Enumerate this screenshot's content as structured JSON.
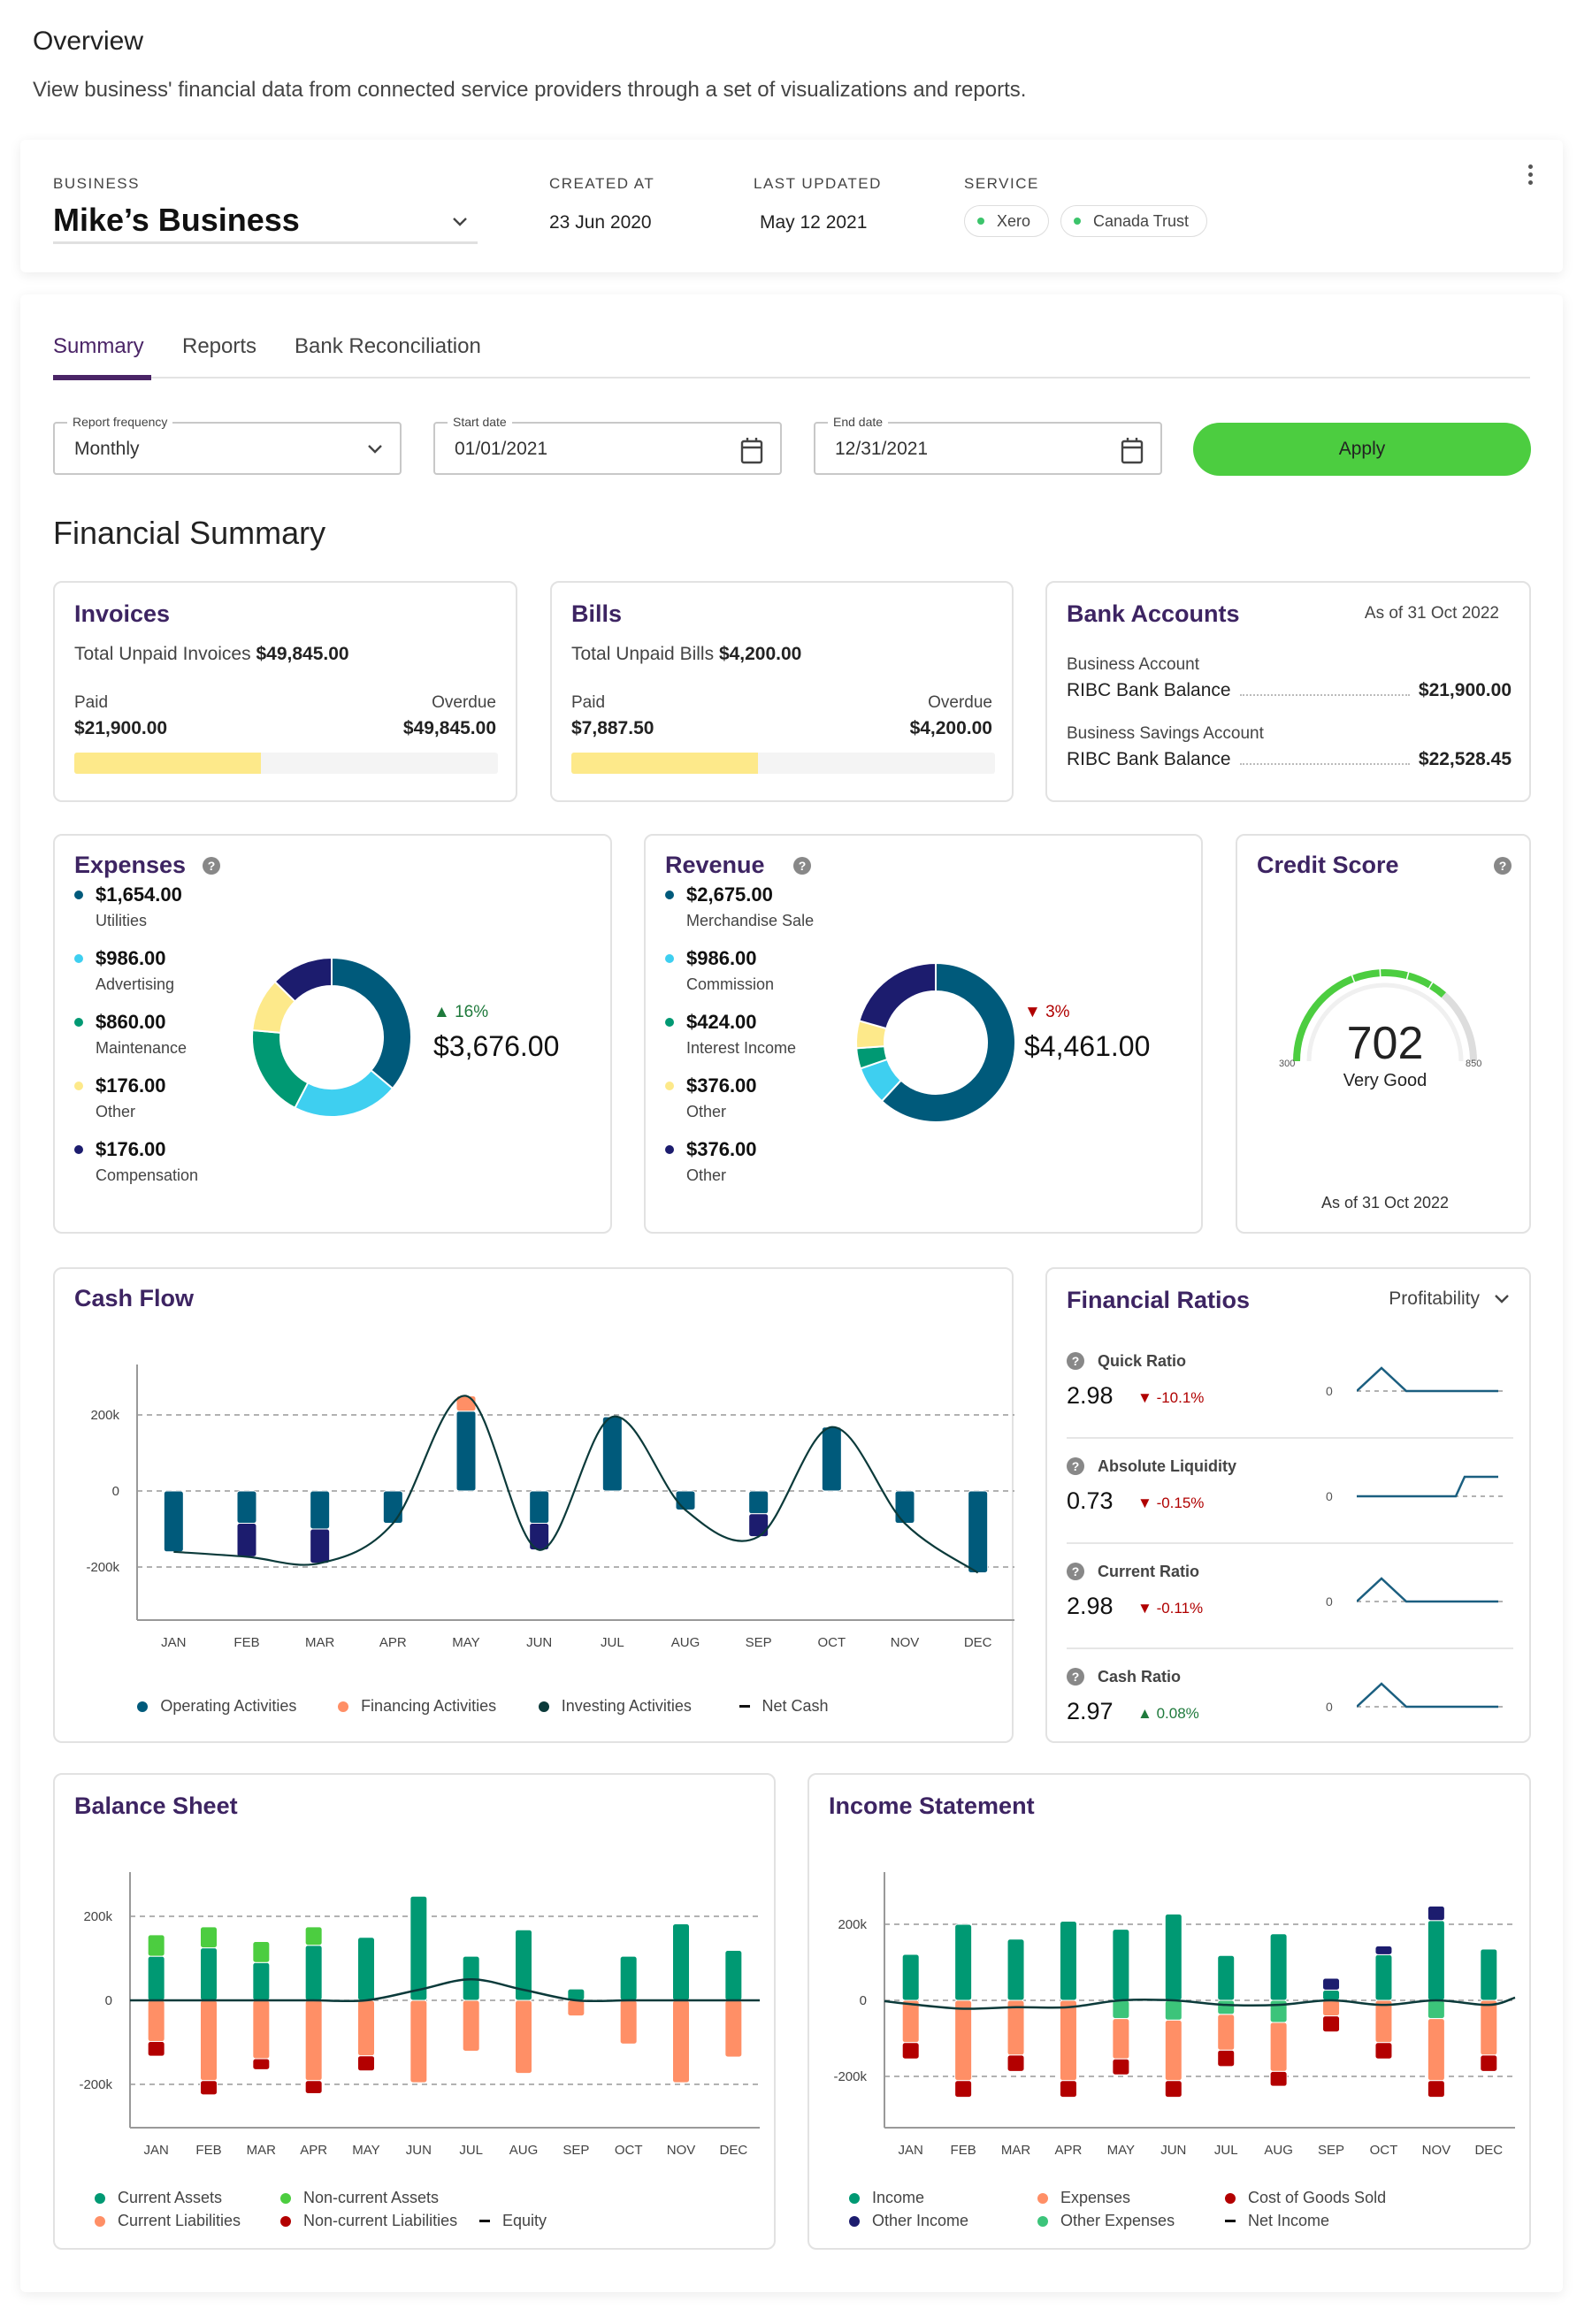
{
  "page": {
    "title": "Overview",
    "subtitle": "View business' financial data from connected service providers through a set of visualizations and reports."
  },
  "header": {
    "business_label": "BUSINESS",
    "business_name": "Mike’s Business",
    "created_label": "CREATED AT",
    "created_value": "23 Jun 2020",
    "updated_label": "LAST UPDATED",
    "updated_value": "May 12 2021",
    "service_label": "SERVICE",
    "services": [
      "Xero",
      "Canada Trust"
    ]
  },
  "tabs": [
    {
      "label": "Summary",
      "active": true
    },
    {
      "label": "Reports",
      "active": false
    },
    {
      "label": "Bank Reconciliation",
      "active": false
    }
  ],
  "filters": {
    "frequency_label": "Report frequency",
    "frequency_value": "Monthly",
    "start_label": "Start date",
    "start_value": "01/01/2021",
    "end_label": "End date",
    "end_value": "12/31/2021",
    "apply_label": "Apply"
  },
  "section_title": "Financial Summary",
  "invoices": {
    "title": "Invoices",
    "total_label": "Total Unpaid Invoices",
    "total_value": "$49,845.00",
    "paid_label": "Paid",
    "paid_value": "$21,900.00",
    "overdue_label": "Overdue",
    "overdue_value": "$49,845.00",
    "paid_fraction": 0.44
  },
  "bills": {
    "title": "Bills",
    "total_label": "Total Unpaid Bills",
    "total_value": "$4,200.00",
    "paid_label": "Paid",
    "paid_value": "$7,887.50",
    "overdue_label": "Overdue",
    "overdue_value": "$4,200.00",
    "paid_fraction": 0.44
  },
  "bank_accounts": {
    "title": "Bank Accounts",
    "as_of": "As of 31 Oct 2022",
    "accounts": [
      {
        "type": "Business Account",
        "name": "RIBC Bank Balance",
        "balance": "$21,900.00"
      },
      {
        "type": "Business Savings Account",
        "name": "RIBC Bank Balance",
        "balance": "$22,528.45"
      }
    ]
  },
  "colors": {
    "brand_purple": "#3d2462",
    "apply_green": "#4ccd40",
    "teal_dark": "#005a7b",
    "cyan": "#3ecff0",
    "green": "#009973",
    "yellow": "#fde98a",
    "navy": "#1c1c6e",
    "orange": "#ff8f66",
    "light_green": "#4ccd40",
    "dark_red": "#b30000",
    "mint": "#3cc47a",
    "up": "#1f7a3c",
    "down": "#b00000"
  },
  "expenses": {
    "title": "Expenses",
    "change": "16%",
    "change_dir": "up",
    "total": "$3,676.00",
    "items": [
      {
        "amount": "$1,654.00",
        "label": "Utilities",
        "value": 1654,
        "color": "#005a7b"
      },
      {
        "amount": "$986.00",
        "label": "Advertising",
        "value": 986,
        "color": "#3ecff0"
      },
      {
        "amount": "$860.00",
        "label": "Maintenance",
        "value": 860,
        "color": "#009973"
      },
      {
        "amount": "$176.00",
        "label": "Other",
        "value": 500,
        "color": "#fde98a"
      },
      {
        "amount": "$176.00",
        "label": "Compensation",
        "value": 580,
        "color": "#1c1c6e"
      }
    ]
  },
  "revenue": {
    "title": "Revenue",
    "change": "3%",
    "change_dir": "down",
    "total": "$4,461.00",
    "items": [
      {
        "amount": "$2,675.00",
        "label": "Merchandise Sale",
        "value": 2675,
        "color": "#005a7b"
      },
      {
        "amount": "$986.00",
        "label": "Commission",
        "value": 340,
        "color": "#3ecff0"
      },
      {
        "amount": "$424.00",
        "label": "Interest Income",
        "value": 180,
        "color": "#009973"
      },
      {
        "amount": "$376.00",
        "label": "Other",
        "value": 240,
        "color": "#fde98a"
      },
      {
        "amount": "$376.00",
        "label": "Other",
        "value": 890,
        "color": "#1c1c6e"
      }
    ]
  },
  "credit_score": {
    "title": "Credit Score",
    "score": "702",
    "score_value": 702,
    "rating": "Very Good",
    "min": "300",
    "max": "850",
    "min_value": 300,
    "max_value": 850,
    "as_of": "As of 31 Oct 2022"
  },
  "ratios": {
    "title": "Financial Ratios",
    "selector": "Profitability",
    "items": [
      {
        "name": "Quick Ratio",
        "value": "2.98",
        "change": "-10.1%",
        "dir": "down",
        "axis": "0",
        "spark": [
          0,
          1,
          0,
          0,
          0,
          0,
          0
        ]
      },
      {
        "name": "Absolute Liquidity",
        "value": "0.73",
        "change": "-0.15%",
        "dir": "down",
        "axis": "0",
        "spark": [
          0,
          0,
          0,
          0,
          0,
          1,
          1
        ]
      },
      {
        "name": "Current Ratio",
        "value": "2.98",
        "change": "-0.11%",
        "dir": "down",
        "axis": "0",
        "spark": [
          0,
          1,
          0,
          0,
          0,
          0,
          0
        ]
      },
      {
        "name": "Cash Ratio",
        "value": "2.97",
        "change": "0.08%",
        "dir": "up",
        "axis": "0",
        "spark": [
          0,
          1,
          0,
          0,
          0,
          0,
          0
        ]
      }
    ]
  },
  "chart_data": [
    {
      "id": "cashflow",
      "type": "bar",
      "title": "Cash Flow",
      "categories": [
        "JAN",
        "FEB",
        "MAR",
        "APR",
        "MAY",
        "JUN",
        "JUL",
        "AUG",
        "SEP",
        "OCT",
        "NOV",
        "DEC"
      ],
      "yticks": [
        "200k",
        "0",
        "-200k"
      ],
      "ytick_values": [
        200,
        0,
        -200
      ],
      "ylim": [
        -340,
        340
      ],
      "grid": true,
      "legend_position": "bottom",
      "series": [
        {
          "name": "Operating Activities",
          "color": "#005a7b",
          "values": [
            -160,
            -85,
            -100,
            -85,
            210,
            -85,
            195,
            -50,
            -60,
            168,
            -85,
            -215
          ]
        },
        {
          "name": "Financing Activities",
          "color": "#ff8f66",
          "values": [
            0,
            0,
            0,
            0,
            40,
            0,
            0,
            0,
            0,
            0,
            0,
            0
          ]
        },
        {
          "name": "Investing Activities",
          "color": "#1c1c6e",
          "values": [
            0,
            -88,
            -90,
            0,
            0,
            -70,
            0,
            0,
            -60,
            0,
            0,
            0
          ]
        }
      ],
      "line": {
        "name": "Net Cash",
        "color": "#0b3a3a",
        "values": [
          -160,
          -173,
          -190,
          -85,
          250,
          -155,
          195,
          -50,
          -120,
          168,
          -85,
          -215
        ]
      },
      "legend": [
        {
          "label": "Operating Activities",
          "color": "#005a7b",
          "kind": "dot"
        },
        {
          "label": "Financing Activities",
          "color": "#ff8f66",
          "kind": "dot"
        },
        {
          "label": "Investing Activities",
          "color": "#0b3a3a",
          "kind": "dot"
        },
        {
          "label": "Net Cash",
          "color": "#111111",
          "kind": "line"
        }
      ]
    },
    {
      "id": "balance",
      "type": "bar",
      "title": "Balance Sheet",
      "categories": [
        "JAN",
        "FEB",
        "MAR",
        "APR",
        "MAY",
        "JUN",
        "JUL",
        "AUG",
        "SEP",
        "OCT",
        "NOV",
        "DEC"
      ],
      "yticks": [
        "200k",
        "0",
        "-200k"
      ],
      "ytick_values": [
        200,
        0,
        -200
      ],
      "ylim": [
        -335,
        335
      ],
      "grid": true,
      "legend_position": "bottom",
      "series": [
        {
          "name": "Current Assets",
          "color": "#009973",
          "values": [
            105,
            125,
            90,
            131,
            150,
            248,
            105,
            168,
            27,
            105,
            182,
            119
          ]
        },
        {
          "name": "Non-current Assets",
          "color": "#4ccd40",
          "values": [
            51,
            50,
            50,
            44,
            0,
            0,
            0,
            0,
            0,
            0,
            0,
            0
          ]
        },
        {
          "name": "Current Liabilities",
          "color": "#ff8f66",
          "values": [
            -98,
            -191,
            -139,
            -191,
            -132,
            -196,
            -121,
            -174,
            -37,
            -104,
            -196,
            -135
          ]
        },
        {
          "name": "Non-current Liabilities",
          "color": "#b30000",
          "values": [
            -35,
            -34,
            -26,
            -31,
            -36,
            0,
            0,
            0,
            0,
            0,
            0,
            0
          ]
        }
      ],
      "line": {
        "name": "Equity",
        "color": "#0b3a3a",
        "values": [
          0,
          0,
          0,
          0,
          0,
          25,
          50,
          25,
          0,
          0,
          0,
          0
        ]
      },
      "legend": [
        {
          "label": "Current Assets",
          "color": "#009973",
          "kind": "dot"
        },
        {
          "label": "Non-current Assets",
          "color": "#4ccd40",
          "kind": "dot"
        },
        {
          "label": "Current Liabilities",
          "color": "#ff8f66",
          "kind": "dot"
        },
        {
          "label": "Non-current Liabilities",
          "color": "#b30000",
          "kind": "dot"
        },
        {
          "label": "Equity",
          "color": "#111111",
          "kind": "line"
        }
      ]
    },
    {
      "id": "income",
      "type": "bar",
      "title": "Income Statement",
      "categories": [
        "JAN",
        "FEB",
        "MAR",
        "APR",
        "MAY",
        "JUN",
        "JUL",
        "AUG",
        "SEP",
        "OCT",
        "NOV",
        "DEC"
      ],
      "yticks": [
        "200k",
        "0",
        "-200k"
      ],
      "ytick_values": [
        200,
        0,
        -200
      ],
      "ylim": [
        -335,
        335
      ],
      "grid": true,
      "legend_position": "bottom",
      "series": [
        {
          "name": "Income",
          "color": "#009973",
          "values": [
            121,
            200,
            161,
            208,
            187,
            227,
            118,
            175,
            27,
            120,
            210,
            135
          ]
        },
        {
          "name": "Other Income",
          "color": "#1c1c6e",
          "values": [
            0,
            0,
            0,
            0,
            0,
            0,
            0,
            0,
            31,
            23,
            38,
            0
          ]
        },
        {
          "name": "Other Expenses",
          "color": "#3cc47a",
          "values": [
            0,
            0,
            0,
            0,
            -48,
            -52,
            -37,
            -58,
            0,
            0,
            -48,
            0
          ]
        },
        {
          "name": "Expenses",
          "color": "#ff8f66",
          "values": [
            -111,
            -211,
            -144,
            -211,
            -106,
            -159,
            -94,
            -129,
            -41,
            -111,
            -163,
            -144
          ]
        },
        {
          "name": "Cost of Goods Sold",
          "color": "#b30000",
          "values": [
            -43,
            -44,
            -43,
            -44,
            -42,
            -44,
            -43,
            -39,
            -42,
            -43,
            -44,
            -43
          ]
        }
      ],
      "line": {
        "name": "Net Income",
        "color": "#0b3a3a",
        "values": [
          -10,
          -22,
          -18,
          -18,
          0,
          0,
          -12,
          -12,
          0,
          -12,
          0,
          -12
        ]
      },
      "legend": [
        {
          "label": "Income",
          "color": "#009973",
          "kind": "dot"
        },
        {
          "label": "Expenses",
          "color": "#ff8f66",
          "kind": "dot"
        },
        {
          "label": "Cost of Goods Sold",
          "color": "#b30000",
          "kind": "dot"
        },
        {
          "label": "Other Income",
          "color": "#1c1c6e",
          "kind": "dot"
        },
        {
          "label": "Other Expenses",
          "color": "#3cc47a",
          "kind": "dot"
        },
        {
          "label": "Net Income",
          "color": "#111111",
          "kind": "line"
        }
      ]
    }
  ]
}
